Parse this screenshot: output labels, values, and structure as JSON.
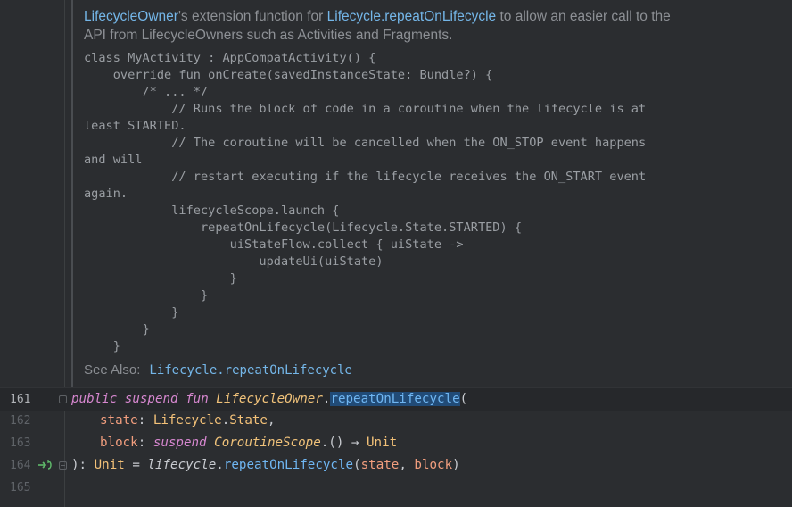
{
  "doc": {
    "intro_link1": "LifecycleOwner",
    "intro_text1": "'s extension function for ",
    "intro_link2": "Lifecycle.repeatOnLifecycle",
    "intro_text2": " to allow an easier call to the API from LifecycleOwners such as Activities and Fragments.",
    "code": "class MyActivity : AppCompatActivity() {\n    override fun onCreate(savedInstanceState: Bundle?) {\n        /* ... */\n            // Runs the block of code in a coroutine when the lifecycle is at\nleast STARTED.\n            // The coroutine will be cancelled when the ON_STOP event happens\nand will\n            // restart executing if the lifecycle receives the ON_START event\nagain.\n            lifecycleScope.launch {\n                repeatOnLifecycle(Lifecycle.State.STARTED) {\n                    uiStateFlow.collect { uiState ->\n                        updateUi(uiState)\n                    }\n                }\n            }\n        }\n    }",
    "see_also_label": "See Also:",
    "see_also_link": "Lifecycle.repeatOnLifecycle"
  },
  "editor": {
    "lines": [
      {
        "number": "161",
        "t1": "public suspend fun",
        "t2": " ",
        "t3": "LifecycleOwner",
        "t4": ".",
        "t5": "repeatOnLifecycle",
        "t6": "("
      },
      {
        "number": "162",
        "t1": "state",
        "t2": ": ",
        "t3": "Lifecycle",
        "t4": ".",
        "t5": "State",
        "t6": ","
      },
      {
        "number": "163",
        "t1": "block",
        "t2": ": ",
        "t3": "suspend",
        "t4": " ",
        "t5": "CoroutineScope",
        "t6": ".() → ",
        "t7": "Unit"
      },
      {
        "number": "164",
        "t1": "): ",
        "t2": "Unit",
        "t3": " = ",
        "t4": "lifecycle",
        "t5": ".",
        "t6": "repeatOnLifecycle",
        "t7": "(",
        "t8": "state",
        "t9": ", ",
        "t10": "block",
        "t11": ")"
      },
      {
        "number": "165"
      }
    ]
  }
}
